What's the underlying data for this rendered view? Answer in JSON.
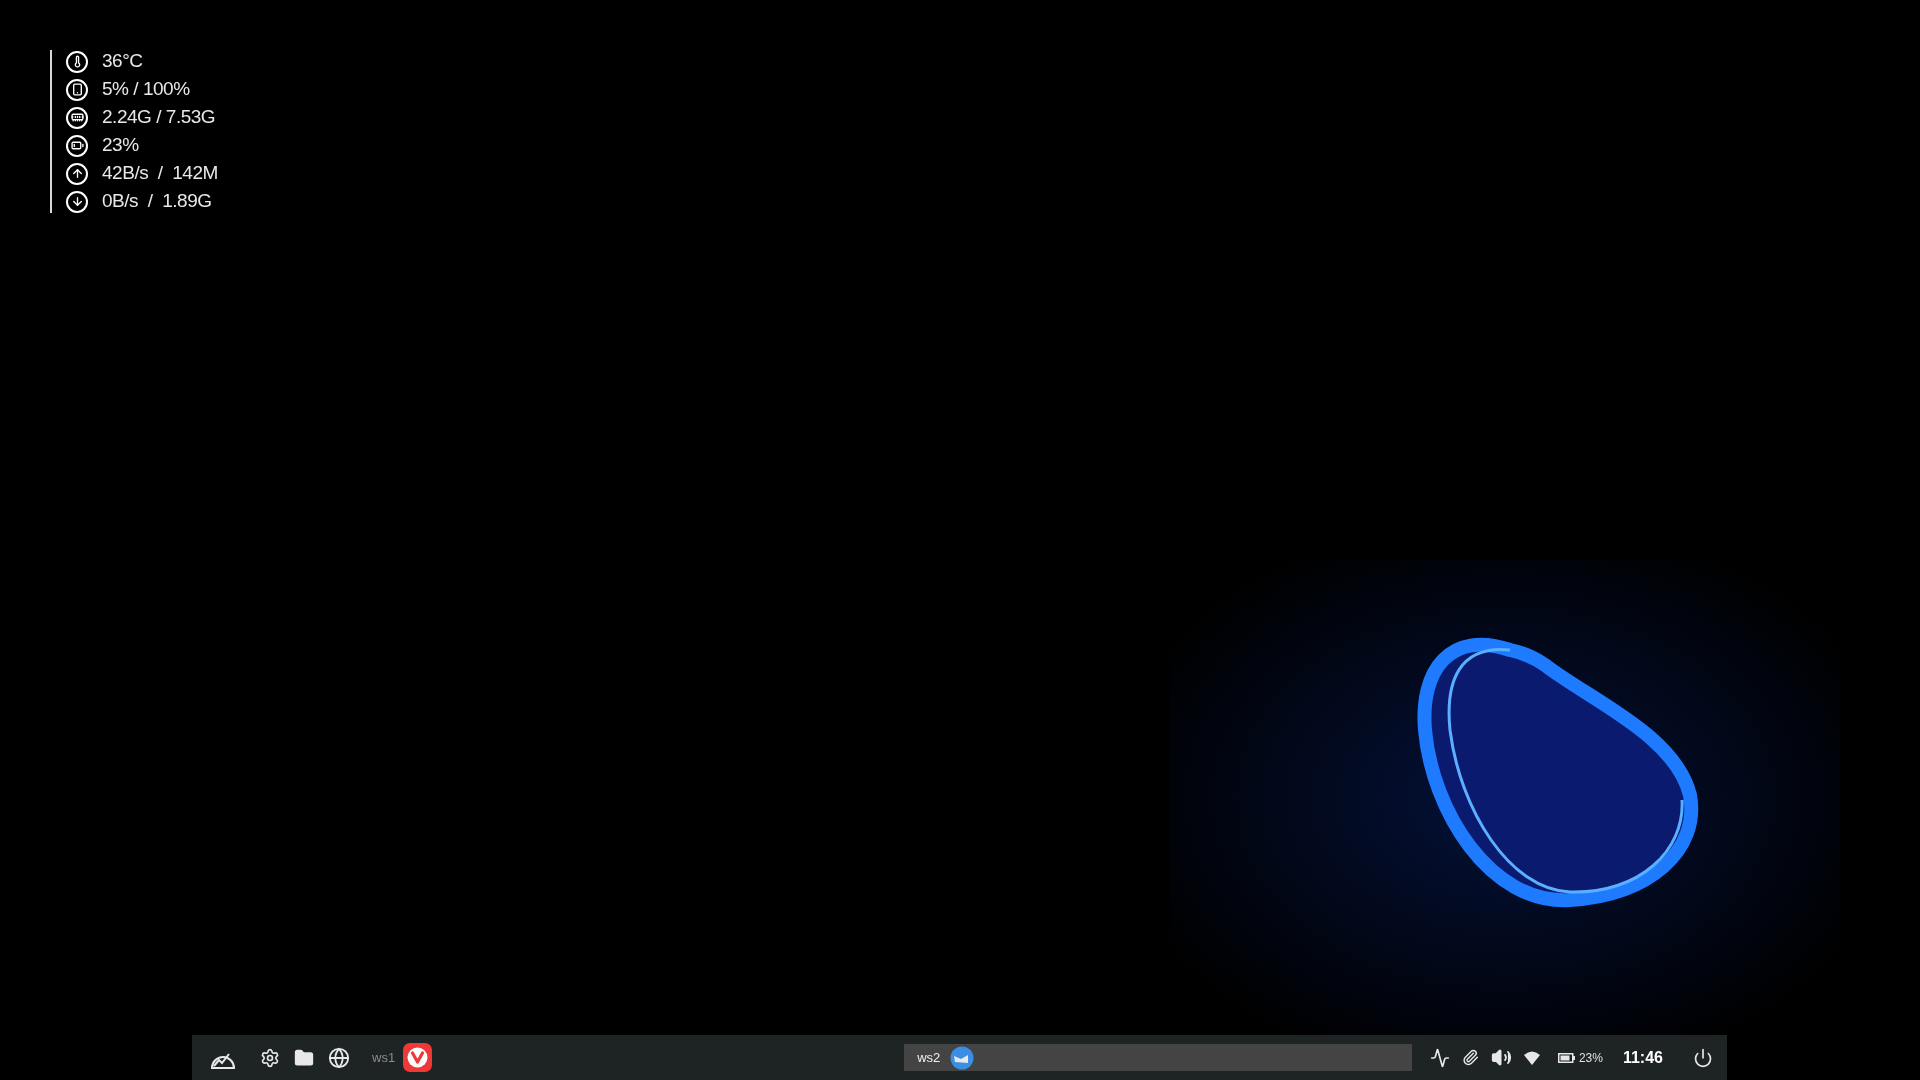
{
  "system_monitor": [
    {
      "kind": "temperature",
      "value": "36°C"
    },
    {
      "kind": "storage",
      "value": "5% / 100%"
    },
    {
      "kind": "memory",
      "value": "2.24G / 7.53G"
    },
    {
      "kind": "battery",
      "value": "23%"
    },
    {
      "kind": "upload",
      "value": "42B/s  /  142M"
    },
    {
      "kind": "download",
      "value": "0B/s  /  1.89G"
    }
  ],
  "taskbar": {
    "workspaces": [
      {
        "label": "ws1",
        "selected": false,
        "kind": "browser"
      },
      {
        "label": "ws2",
        "selected": true,
        "kind": "mail"
      }
    ],
    "battery": "23%",
    "clock": "11:46"
  }
}
